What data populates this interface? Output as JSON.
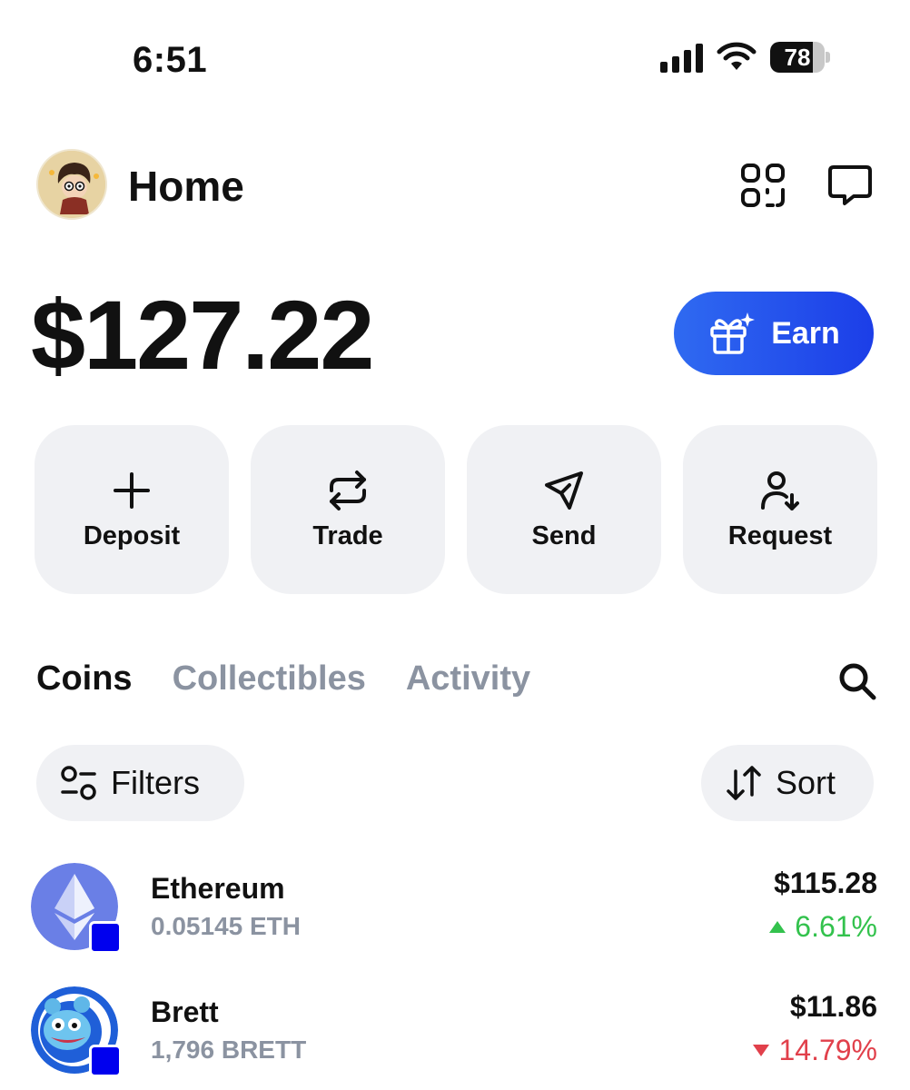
{
  "status_bar": {
    "time": "6:51",
    "battery": "78",
    "battery_level": 0.78,
    "icons": [
      "signal-icon",
      "wifi-icon",
      "battery-icon"
    ]
  },
  "header": {
    "title": "Home",
    "icons": [
      "avatar",
      "scan-icon",
      "chat-icon"
    ]
  },
  "balance": "$127.22",
  "earn_button": {
    "label": "Earn",
    "icon": "gift-sparkle-icon"
  },
  "actions": [
    {
      "label": "Deposit",
      "icon": "plus-icon"
    },
    {
      "label": "Trade",
      "icon": "swap-icon"
    },
    {
      "label": "Send",
      "icon": "send-icon"
    },
    {
      "label": "Request",
      "icon": "user-request-icon"
    }
  ],
  "tabs": [
    {
      "label": "Coins",
      "active": true
    },
    {
      "label": "Collectibles",
      "active": false
    },
    {
      "label": "Activity",
      "active": false
    }
  ],
  "filters": {
    "label": "Filters",
    "icon": "filters-icon"
  },
  "sort": {
    "label": "Sort",
    "icon": "sort-arrows-icon"
  },
  "coins": [
    {
      "name": "Ethereum",
      "amount": "0.05145 ETH",
      "value": "$115.28",
      "change": "6.61%",
      "direction": "up",
      "logo": "ethereum-logo"
    },
    {
      "name": "Brett",
      "amount": "1,796 BRETT",
      "value": "$11.86",
      "change": "14.79%",
      "direction": "down",
      "logo": "brett-logo"
    }
  ],
  "colors": {
    "accent": "#2a55ee",
    "positive": "#33c24d",
    "negative": "#e1404b",
    "muted": "#8b93a1",
    "chip_bg": "#f0f1f4",
    "chain_badge": "#0000ee"
  }
}
